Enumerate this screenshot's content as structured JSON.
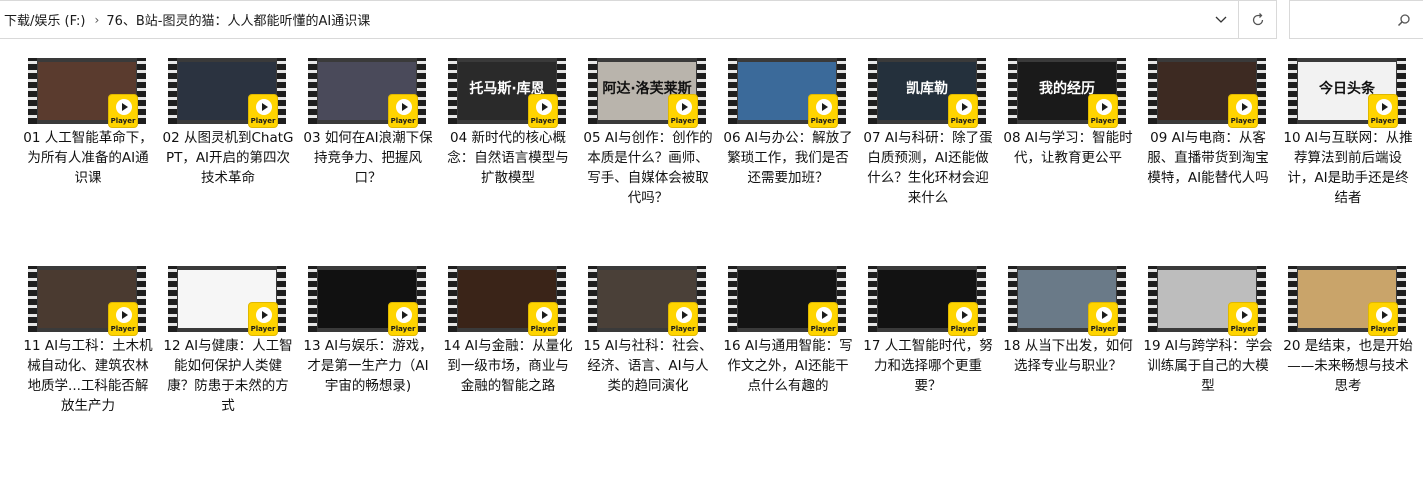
{
  "breadcrumb": {
    "items": [
      "下载/娱乐 (F:)",
      "76、B站-图灵的猫：人人都能听懂的AI通识课"
    ]
  },
  "search": {
    "placeholder": ""
  },
  "icons": {
    "separator": "chevron-right-icon",
    "dropdown": "chevron-down-icon",
    "refresh": "refresh-icon",
    "search": "search-icon",
    "player_badge": "player-icon"
  },
  "colors": {
    "player_badge": "#ffd400",
    "film_strip": "#1e1e1e"
  },
  "files": [
    {
      "label": "01 人工智能革命下，为所有人准备的AI通识课",
      "thumb_text": "",
      "thumb_bg": "#5a3b2e"
    },
    {
      "label": "02 从图灵机到ChatGPT，AI开启的第四次技术革命",
      "thumb_text": "",
      "thumb_bg": "#2b3340"
    },
    {
      "label": "03 如何在AI浪潮下保持竞争力、把握风口？",
      "thumb_text": "",
      "thumb_bg": "#4a4a5a"
    },
    {
      "label": "04 新时代的核心概念：自然语言模型与扩散模型",
      "thumb_text": "托马斯·库恩",
      "thumb_bg": "#2a2a2a"
    },
    {
      "label": "05 AI与创作：创作的本质是什么？画师、写手、自媒体会被取代吗？",
      "thumb_text": "阿达·洛芙莱斯",
      "thumb_bg": "#b9b4ac"
    },
    {
      "label": "06 AI与办公：解放了繁琐工作，我们是否还需要加班？",
      "thumb_text": "",
      "thumb_bg": "#3b6a9a"
    },
    {
      "label": "07 AI与科研：除了蛋白质预测，AI还能做什么？生化环材会迎来什么",
      "thumb_text": "凯库勒",
      "thumb_bg": "#24303c"
    },
    {
      "label": "08 AI与学习：智能时代，让教育更公平",
      "thumb_text": "我的经历",
      "thumb_bg": "#1a1a1a"
    },
    {
      "label": "09 AI与电商：从客服、直播带货到淘宝模特，AI能替代人吗",
      "thumb_text": "",
      "thumb_bg": "#3d2a22"
    },
    {
      "label": "10 AI与互联网：从推荐算法到前后端设计，AI是助手还是终结者",
      "thumb_text": "今日头条",
      "thumb_bg": "#f2f2f2"
    },
    {
      "label": "11 AI与工科：土木机械自动化、建筑农林地质学...工科能否解放生产力",
      "thumb_text": "",
      "thumb_bg": "#4a3a30"
    },
    {
      "label": "12 AI与健康：人工智能如何保护人类健康？防患于未然的方式",
      "thumb_text": "",
      "thumb_bg": "#f6f6f6"
    },
    {
      "label": "13 AI与娱乐：游戏，才是第一生产力（AI宇宙的畅想录)",
      "thumb_text": "",
      "thumb_bg": "#111111"
    },
    {
      "label": "14 AI与金融：从量化到一级市场，商业与金融的智能之路",
      "thumb_text": "",
      "thumb_bg": "#3a2418"
    },
    {
      "label": "15 AI与社科：社会、经济、语言、AI与人类的趋同演化",
      "thumb_text": "",
      "thumb_bg": "#4a4038"
    },
    {
      "label": "16 AI与通用智能：写作文之外，AI还能干点什么有趣的",
      "thumb_text": "",
      "thumb_bg": "#141414"
    },
    {
      "label": "17 人工智能时代，努力和选择哪个更重要？",
      "thumb_text": "",
      "thumb_bg": "#121212"
    },
    {
      "label": "18 从当下出发，如何选择专业与职业？",
      "thumb_text": "",
      "thumb_bg": "#6a7a88"
    },
    {
      "label": "19 AI与跨学科：学会训练属于自己的大模型",
      "thumb_text": "",
      "thumb_bg": "#bdbdbd"
    },
    {
      "label": "20 是结束，也是开始——未来畅想与技术思考",
      "thumb_text": "",
      "thumb_bg": "#c9a46a"
    }
  ],
  "player_badge_label": "Player"
}
